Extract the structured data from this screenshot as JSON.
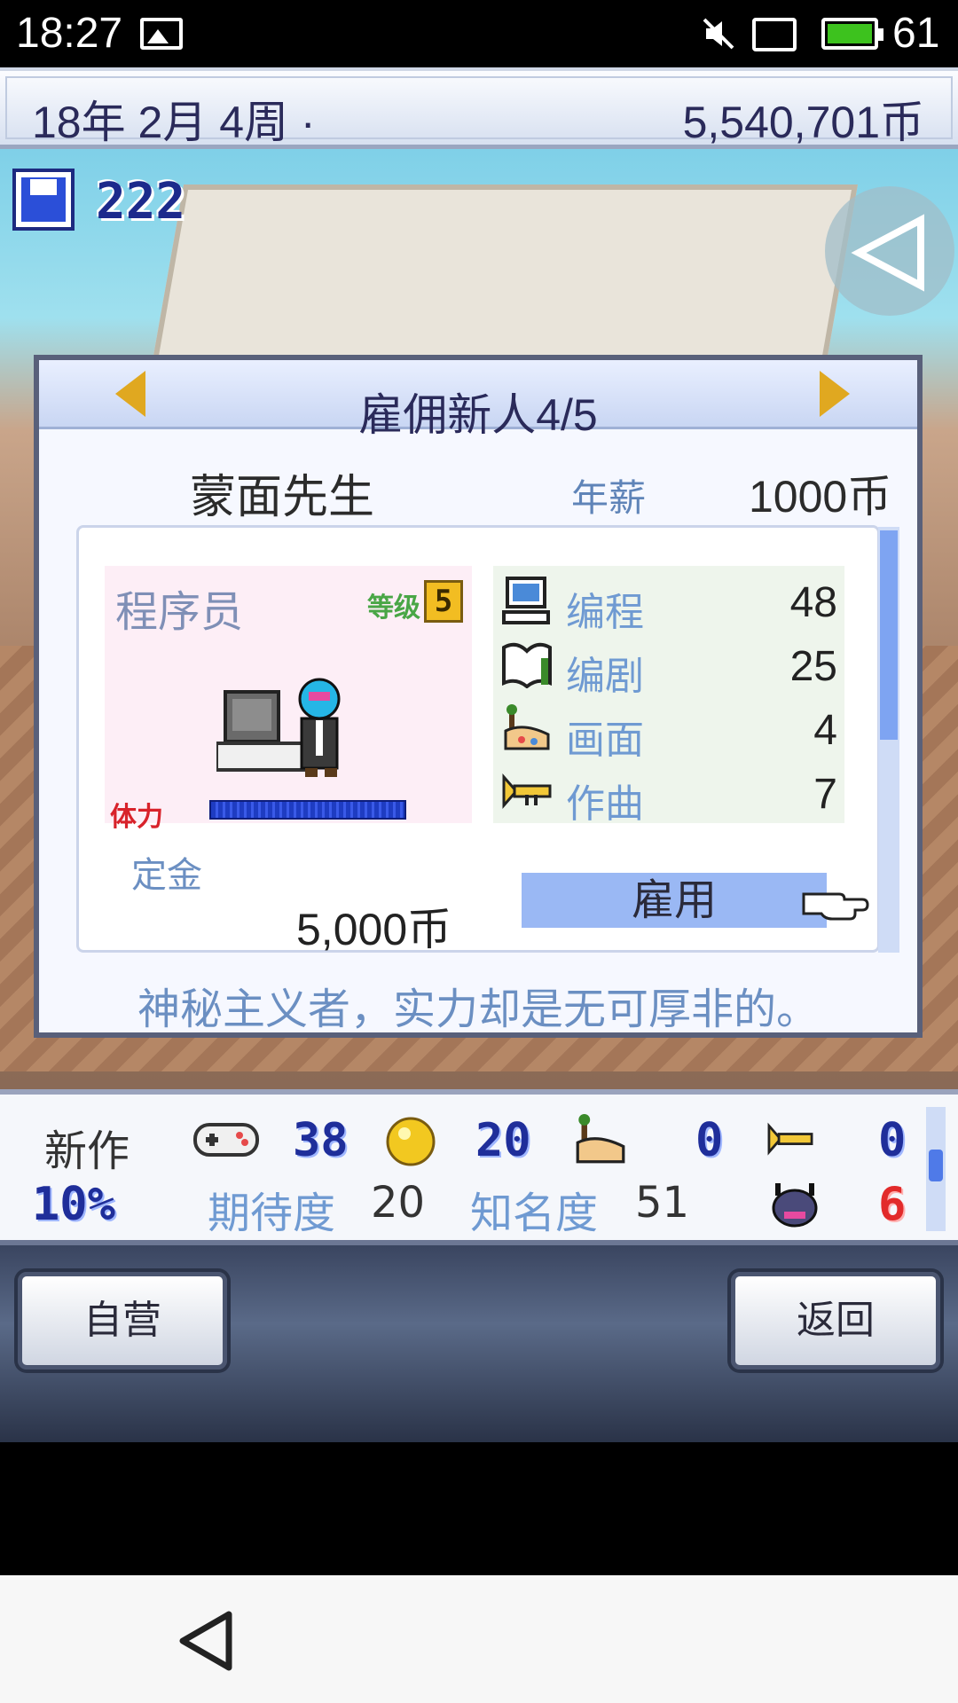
{
  "status_bar": {
    "time": "18:27",
    "battery": "61"
  },
  "top_bar": {
    "date": "18年 2月 4周 ·",
    "money": "5,540,701币"
  },
  "scene": {
    "save_count": "222"
  },
  "dialog": {
    "title": "雇佣新人4/5",
    "name": "蒙面先生",
    "salary_label": "年薪",
    "salary_value": "1000币",
    "job": "程序员",
    "level_label": "等级",
    "level": "5",
    "hp_label": "体力",
    "stats": [
      {
        "icon": "computer-icon",
        "label": "编程",
        "value": "48"
      },
      {
        "icon": "book-icon",
        "label": "编剧",
        "value": "25"
      },
      {
        "icon": "palette-icon",
        "label": "画面",
        "value": "4"
      },
      {
        "icon": "trumpet-icon",
        "label": "作曲",
        "value": "7"
      }
    ],
    "deposit_label": "定金",
    "deposit_value": "5,000币",
    "hire_label": "雇用",
    "description": "神秘主义者，实力却是无可厚非的。"
  },
  "bottom_bar": {
    "new_game_label": "新作",
    "progress": "10%",
    "stat_fun": "38",
    "stat_creativity": "20",
    "stat_graphics": "0",
    "stat_sound": "0",
    "expectation_label": "期待度",
    "expectation_value": "20",
    "fame_label": "知名度",
    "fame_value": "51",
    "bugs": "6"
  },
  "buttons": {
    "self_run": "自营",
    "back": "返回"
  },
  "colors": {
    "accent_blue": "#9ab8f4",
    "title_text": "#2a2a5a",
    "stat_label": "#6f9ad2"
  }
}
